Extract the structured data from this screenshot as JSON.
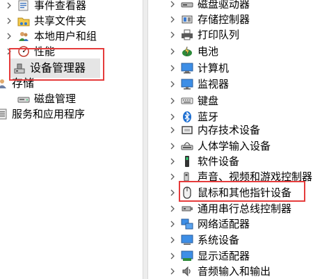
{
  "left_tree": {
    "items": [
      {
        "label": "事件查看器",
        "icon": "event-viewer-icon",
        "chevron": true
      },
      {
        "label": "共享文件夹",
        "icon": "shared-folder-icon",
        "chevron": true
      },
      {
        "label": "本地用户和组",
        "icon": "local-users-icon",
        "chevron": true
      },
      {
        "label": "性能",
        "icon": "performance-icon",
        "chevron": true
      },
      {
        "label": "设备管理器",
        "icon": "device-manager-icon",
        "chevron": false,
        "selected": true
      },
      {
        "label": "存储",
        "icon": "storage-icon",
        "chevron": false
      },
      {
        "label": "磁盘管理",
        "icon": "disk-management-icon",
        "chevron": false
      },
      {
        "label": "服务和应用程序",
        "icon": "services-apps-icon",
        "chevron": false
      }
    ]
  },
  "right_tree": {
    "items": [
      {
        "label": "磁盘驱动器",
        "icon": "disk-drive-icon"
      },
      {
        "label": "存储控制器",
        "icon": "storage-controller-icon"
      },
      {
        "label": "打印队列",
        "icon": "printer-icon"
      },
      {
        "label": "电池",
        "icon": "battery-icon"
      },
      {
        "label": "计算机",
        "icon": "computer-icon"
      },
      {
        "label": "监视器",
        "icon": "monitor-icon"
      },
      {
        "label": "键盘",
        "icon": "keyboard-icon"
      },
      {
        "label": "蓝牙",
        "icon": "bluetooth-icon"
      },
      {
        "label": "内存技术设备",
        "icon": "memory-device-icon"
      },
      {
        "label": "人体学输入设备",
        "icon": "hid-icon"
      },
      {
        "label": "软件设备",
        "icon": "software-device-icon"
      },
      {
        "label": "声音、视频和游戏控制器",
        "icon": "sound-icon"
      },
      {
        "label": "鼠标和其他指针设备",
        "icon": "mouse-icon",
        "highlighted": true
      },
      {
        "label": "通用串行总线控制器",
        "icon": "usb-icon"
      },
      {
        "label": "网络适配器",
        "icon": "network-adapter-icon"
      },
      {
        "label": "系统设备",
        "icon": "system-device-icon"
      },
      {
        "label": "显示适配器",
        "icon": "display-adapter-icon"
      },
      {
        "label": "音频输入和输出",
        "icon": "audio-io-icon"
      }
    ]
  },
  "colors": {
    "selection": "#e5e5e5",
    "highlight_border": "#e53b3b",
    "chevron": "#5c5c5c"
  }
}
